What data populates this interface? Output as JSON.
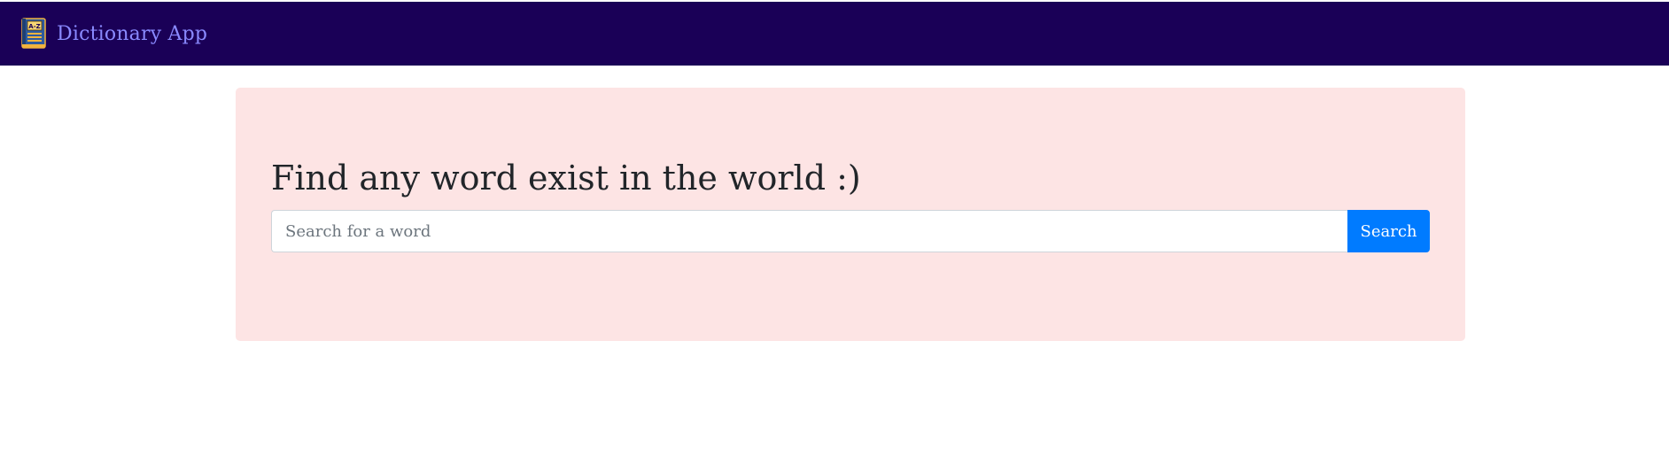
{
  "navbar": {
    "brand_icon": "dictionary-book-icon",
    "brand_text": "Dictionary App",
    "background_color": "#1a0057",
    "brand_color": "#8a8aff"
  },
  "hero": {
    "title": "Find any word exist in the world :)",
    "background_color": "#fde4e4"
  },
  "search": {
    "value": "",
    "placeholder": "Search for a word",
    "button_label": "Search",
    "button_color": "#007bff"
  }
}
